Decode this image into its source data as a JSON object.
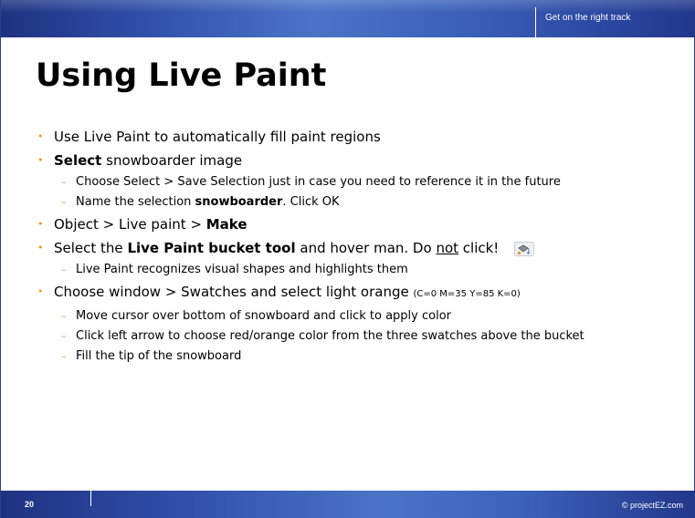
{
  "header": {
    "tagline": "Get on the right track"
  },
  "title": "Using Live Paint",
  "bullets": {
    "b1": {
      "text": "Use Live Paint to automatically fill paint regions"
    },
    "b2": {
      "bold": "Select",
      "rest": " snowboarder image"
    },
    "b2a": {
      "text": "Choose Select > Save Selection just in case you need to reference it in the future"
    },
    "b2b": {
      "pre": "Name the selection ",
      "bold": "snowboarder",
      "post": ".  Click OK"
    },
    "b3": {
      "pre": "Object > Live paint > ",
      "bold": "Make"
    },
    "b4": {
      "pre": "Select the ",
      "bold": "Live Paint bucket tool",
      "mid": " and hover man. Do ",
      "underline": "not",
      "post": " click!"
    },
    "b4a": {
      "text": "Live Paint recognizes visual shapes and highlights them"
    },
    "b5": {
      "text": "Choose window > Swatches and select light orange ",
      "small": "(C=0 M=35 Y=85 K=0)"
    },
    "b5a": {
      "text": "Move cursor over bottom of snowboard and click to apply color"
    },
    "b5b": {
      "text": "Click left arrow to choose red/orange color from the three swatches above the bucket"
    },
    "b5c": {
      "text": "Fill the tip of the snowboard"
    }
  },
  "icons": {
    "bucket": "live-paint-bucket-icon"
  },
  "footer": {
    "page_number": "20",
    "copyright": "© projectEZ.com"
  },
  "colors": {
    "bar": "#2f4ea8",
    "bullet": "#e39a2a"
  }
}
